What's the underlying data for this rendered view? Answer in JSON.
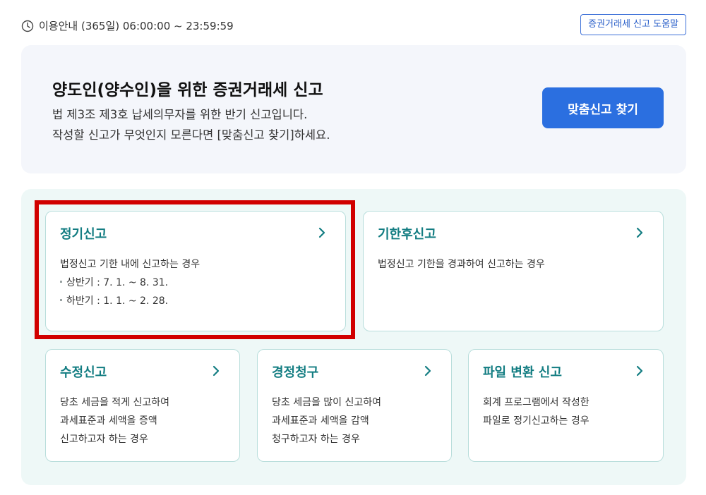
{
  "header": {
    "hours_text": "이용안내 (365일) 06:00:00 ~ 23:59:59",
    "help_button": "증권거래세 신고 도움말"
  },
  "intro": {
    "title": "양도인(양수인)을 위한 증권거래세 신고",
    "desc_line1": "법 제3조 제3호 납세의무자를 위한 반기 신고입니다.",
    "desc_line2": "작성할 신고가 무엇인지 모른다면 [맞춤신고 찾기]하세요.",
    "find_button": "맞춤신고 찾기"
  },
  "cards": [
    {
      "title": "정기신고",
      "lines": [
        "법정신고 기한 내에 신고하는 경우",
        "상반기 : 7. 1. ~ 8. 31.",
        "하반기 : 1. 1. ~ 2. 28."
      ]
    },
    {
      "title": "기한후신고",
      "lines": [
        "법정신고 기한을 경과하여 신고하는 경우"
      ]
    },
    {
      "title": "수정신고",
      "lines": [
        "당초 세금을 적게 신고하여",
        "과세표준과 세액을 증액",
        "신고하고자 하는 경우"
      ]
    },
    {
      "title": "경정청구",
      "lines": [
        "당초 세금을 많이 신고하여",
        "과세표준과 세액을 감액",
        "청구하고자 하는 경우"
      ]
    },
    {
      "title": "파일 변환 신고",
      "lines": [
        "회계 프로그램에서 작성한",
        "파일로 정기신고하는 경우"
      ]
    }
  ],
  "icons": {
    "clock": "clock-icon",
    "chevron": "chevron-right-icon"
  },
  "colors": {
    "accent_blue": "#2b6fe0",
    "card_title_teal": "#137d82",
    "highlight_red": "#d10000"
  }
}
